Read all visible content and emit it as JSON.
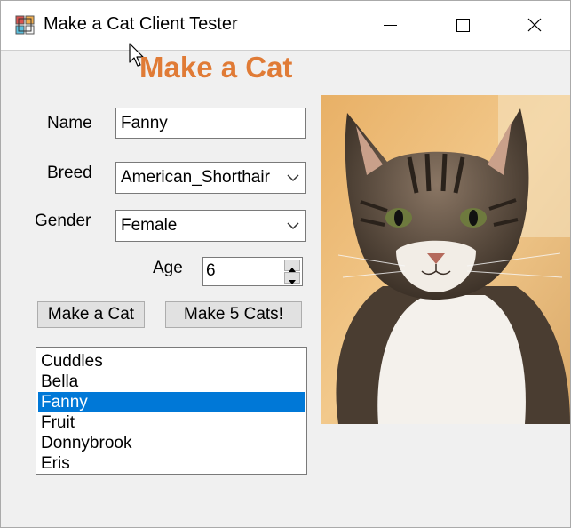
{
  "window": {
    "title": "Make a Cat Client Tester",
    "controls": [
      "minimize",
      "maximize",
      "close"
    ]
  },
  "form": {
    "heading": "Make a Cat",
    "heading_color": "#e07b36",
    "name_label": "Name",
    "name_value": "Fanny",
    "breed_label": "Breed",
    "breed_value": "American_Shorthair",
    "gender_label": "Gender",
    "gender_value": "Female",
    "age_label": "Age",
    "age_value": "6",
    "make_cat_button": "Make a Cat",
    "make_5_cats_button": "Make 5 Cats!"
  },
  "cat_list": {
    "items": [
      "Cuddles",
      "Bella",
      "Fanny",
      "Fruit",
      "Donnybrook",
      "Eris"
    ],
    "selected_index": 2,
    "selection_color": "#0078d7"
  },
  "photo": {
    "subject": "tabby-and-white-cat"
  }
}
